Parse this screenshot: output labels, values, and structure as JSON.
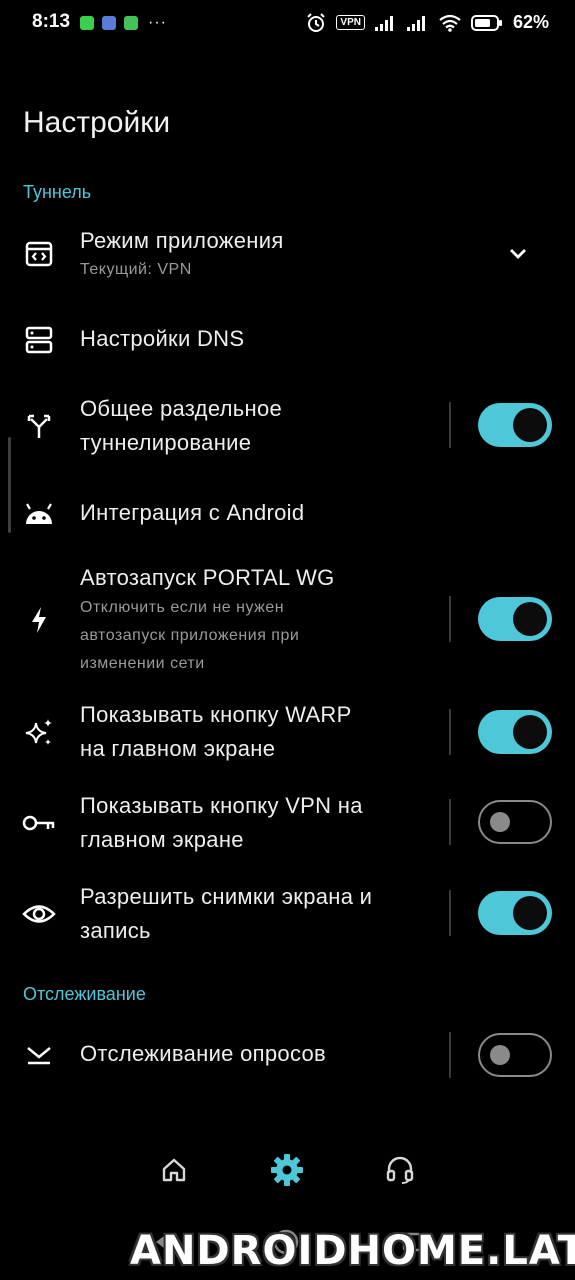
{
  "status_bar": {
    "time": "8:13",
    "notification_icons": [
      "whatsapp-icon",
      "app-icon",
      "app-icon"
    ],
    "overflow": "···",
    "vpn_badge": "VPN",
    "battery_percent": "62%"
  },
  "page_title": "Настройки",
  "sections": {
    "tunnel": "Туннель",
    "tracking": "Отслеживание"
  },
  "settings": {
    "app_mode": {
      "title": "Режим приложения",
      "subtitle": "Текущий: VPN",
      "icon": "app-window-icon"
    },
    "dns": {
      "title": "Настройки DNS",
      "icon": "dns-server-icon"
    },
    "split_tunnel": {
      "title_line1": "Общее раздельное",
      "title_line2": "туннелирование",
      "enabled": true,
      "icon": "split-arrows-icon"
    },
    "android_integration": {
      "title": "Интеграция с Android",
      "icon": "android-icon"
    },
    "autostart": {
      "title": "Автозапуск PORTAL WG",
      "subtitle_line1": "Отключить если не нужен",
      "subtitle_line2": "автозапуск приложения при",
      "subtitle_line3": "изменении сети",
      "enabled": true,
      "icon": "bolt-icon"
    },
    "warp_button": {
      "title_line1": "Показывать кнопку WARP",
      "title_line2": "на главном экране",
      "enabled": true,
      "icon": "sparkles-icon"
    },
    "vpn_button": {
      "title_line1": "Показывать кнопку VPN на",
      "title_line2": "главном экране",
      "enabled": false,
      "icon": "key-icon"
    },
    "screenshots": {
      "title_line1": "Разрешить снимки экрана и",
      "title_line2": "запись",
      "enabled": true,
      "icon": "eye-icon"
    },
    "poll_tracking": {
      "title": "Отслеживание опросов",
      "enabled": false,
      "icon": "tracking-icon"
    }
  },
  "bottom_nav": [
    "home-icon",
    "settings-icon",
    "headset-icon"
  ],
  "colors": {
    "accent": "#4ec7d9",
    "section": "#52c6d8",
    "background": "#000000"
  },
  "watermark": "ANDROIDHOME.LAT"
}
